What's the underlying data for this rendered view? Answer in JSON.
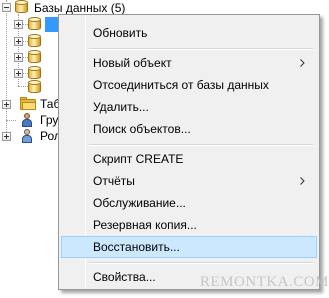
{
  "tree": {
    "root_label": "Базы данных (5)",
    "selected_item_label": "",
    "partial_labels": [
      "Таб",
      "Гру",
      "Рол"
    ]
  },
  "menu": {
    "items": [
      {
        "label": "Обновить",
        "submenu": false
      },
      {
        "label": "Новый объект",
        "submenu": true
      },
      {
        "label": "Отсоединиться от базы данных",
        "submenu": false
      },
      {
        "label": "Удалить...",
        "submenu": false
      },
      {
        "label": "Поиск объектов...",
        "submenu": false
      },
      {
        "label": "Скрипт CREATE",
        "submenu": false
      },
      {
        "label": "Отчёты",
        "submenu": true
      },
      {
        "label": "Обслуживание...",
        "submenu": false
      },
      {
        "label": "Резервная копия...",
        "submenu": false
      },
      {
        "label": "Восстановить...",
        "submenu": false,
        "highlighted": true
      },
      {
        "label": "Свойства...",
        "submenu": false
      }
    ]
  },
  "watermark": "REMONTKA.COM",
  "colors": {
    "menu_background": "#f0f0f0",
    "highlight_background": "#cce8ff",
    "highlight_border": "#99d1ff",
    "selection_blue": "#3399ff"
  },
  "icons": [
    "database-icon",
    "folder-icon",
    "user-group-icon",
    "roles-icon",
    "submenu-arrow-icon"
  ]
}
